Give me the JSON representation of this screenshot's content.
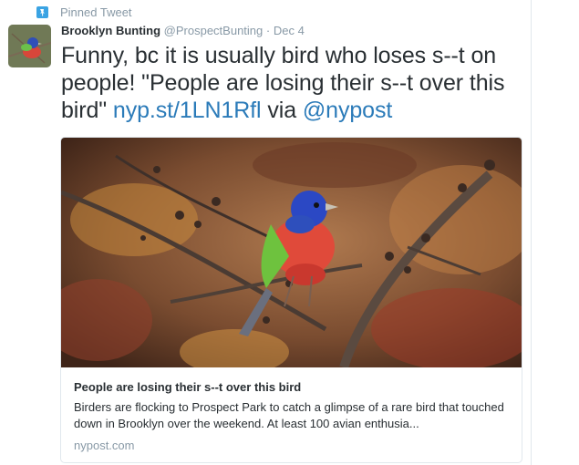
{
  "pinned": {
    "label": "Pinned Tweet",
    "icon": "pin-icon"
  },
  "tweet": {
    "author_name": "Brooklyn Bunting",
    "handle": "@ProspectBunting",
    "separator": "·",
    "date": "Dec 4",
    "text_plain": "Funny, bc it is usually bird who loses s--t on people! \"People are losing their s--t over this bird\" ",
    "link": "nyp.st/1LN1Rfl",
    "via": " via ",
    "mention": "@nypost"
  },
  "card": {
    "title": "People are losing their s--t over this bird",
    "description": "Birders are flocking to Prospect Park to catch a glimpse of a rare bird that touched down in Brooklyn over the weekend. At least 100 avian enthusia...",
    "domain": "nypost.com"
  },
  "colors": {
    "link": "#2b7bb9",
    "muted": "#8899a6",
    "text": "#292f33",
    "pin": "#3aa3e3"
  }
}
